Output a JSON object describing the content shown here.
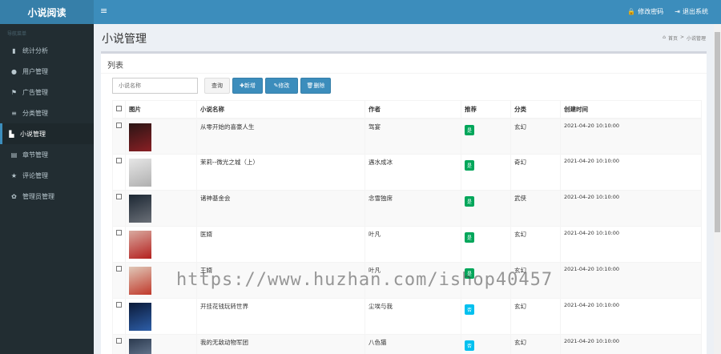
{
  "app": {
    "logo": "小说阅读"
  },
  "topbar": {
    "menu_icon": "≡",
    "change_password": "修改密码",
    "logout": "退出系统"
  },
  "sidebar": {
    "header": "导航菜单",
    "items": [
      {
        "icon": "bar-chart-icon",
        "glyph": "▮",
        "label": "统计分析"
      },
      {
        "icon": "user-icon",
        "glyph": "●",
        "label": "用户管理"
      },
      {
        "icon": "flag-icon",
        "glyph": "⚑",
        "label": "广告管理"
      },
      {
        "icon": "list-icon",
        "glyph": "≡",
        "label": "分类管理"
      },
      {
        "icon": "book-icon",
        "glyph": "▙",
        "label": "小说管理",
        "active": true
      },
      {
        "icon": "file-icon",
        "glyph": "▤",
        "label": "章节管理"
      },
      {
        "icon": "star-icon",
        "glyph": "★",
        "label": "评论管理"
      },
      {
        "icon": "gear-icon",
        "glyph": "✿",
        "label": "管理员管理"
      }
    ]
  },
  "page": {
    "title": "小说管理",
    "breadcrumb_home": "首页",
    "breadcrumb_sep": ">",
    "breadcrumb_current": "小说管理"
  },
  "box": {
    "title": "列表"
  },
  "toolbar": {
    "search_placeholder": "小说名称",
    "query": "查询",
    "add": "✚新增",
    "edit": "✎修改",
    "delete": "🗑删除"
  },
  "table": {
    "headers": [
      "图片",
      "小说名称",
      "作者",
      "推荐",
      "分类",
      "创建时间"
    ],
    "rows": [
      {
        "name": "从零开始的喜豪人生",
        "author": "驾宴",
        "recommend": "是",
        "category": "玄幻",
        "time": "2021-04-20 10:10:00",
        "cover_colors": [
          "#2a1515",
          "#8a1f24"
        ]
      },
      {
        "name": "茉莉--微光之城（上）",
        "author": "遇水成冰",
        "recommend": "是",
        "category": "奇幻",
        "time": "2021-04-20 10:10:00",
        "cover_colors": [
          "#e6e6e6",
          "#b0b0b0"
        ]
      },
      {
        "name": "诸神基金会",
        "author": "念雪独席",
        "recommend": "是",
        "category": "武侠",
        "time": "2021-04-20 10:10:00",
        "cover_colors": [
          "#1c2733",
          "#6a6f77"
        ]
      },
      {
        "name": "医婿",
        "author": "叶凡",
        "recommend": "是",
        "category": "玄幻",
        "time": "2021-04-20 10:10:00",
        "cover_colors": [
          "#d9aaa0",
          "#b4201e"
        ]
      },
      {
        "name": "王婿",
        "author": "叶凡",
        "recommend": "是",
        "category": "玄幻",
        "time": "2021-04-20 10:10:00",
        "cover_colors": [
          "#e0c8b8",
          "#c0392b"
        ]
      },
      {
        "name": "开挂花钱玩转世界",
        "author": "尘埃与我",
        "recommend": "否",
        "category": "玄幻",
        "time": "2021-04-20 10:10:00",
        "cover_colors": [
          "#0b1a38",
          "#2d5ea8"
        ]
      },
      {
        "name": "我的无敌动物军团",
        "author": "八色猫",
        "recommend": "否",
        "category": "玄幻",
        "time": "2021-04-20 10:10:00",
        "cover_colors": [
          "#2b3a4f",
          "#7d8fa8"
        ]
      }
    ]
  },
  "colors": {
    "header": "#3c8dbc",
    "logo_bg": "#367fa9",
    "sidebar": "#222d32",
    "yes_badge": "#00a65a",
    "no_badge": "#00c0ef"
  },
  "watermark": "https://www.huzhan.com/ishop40457"
}
